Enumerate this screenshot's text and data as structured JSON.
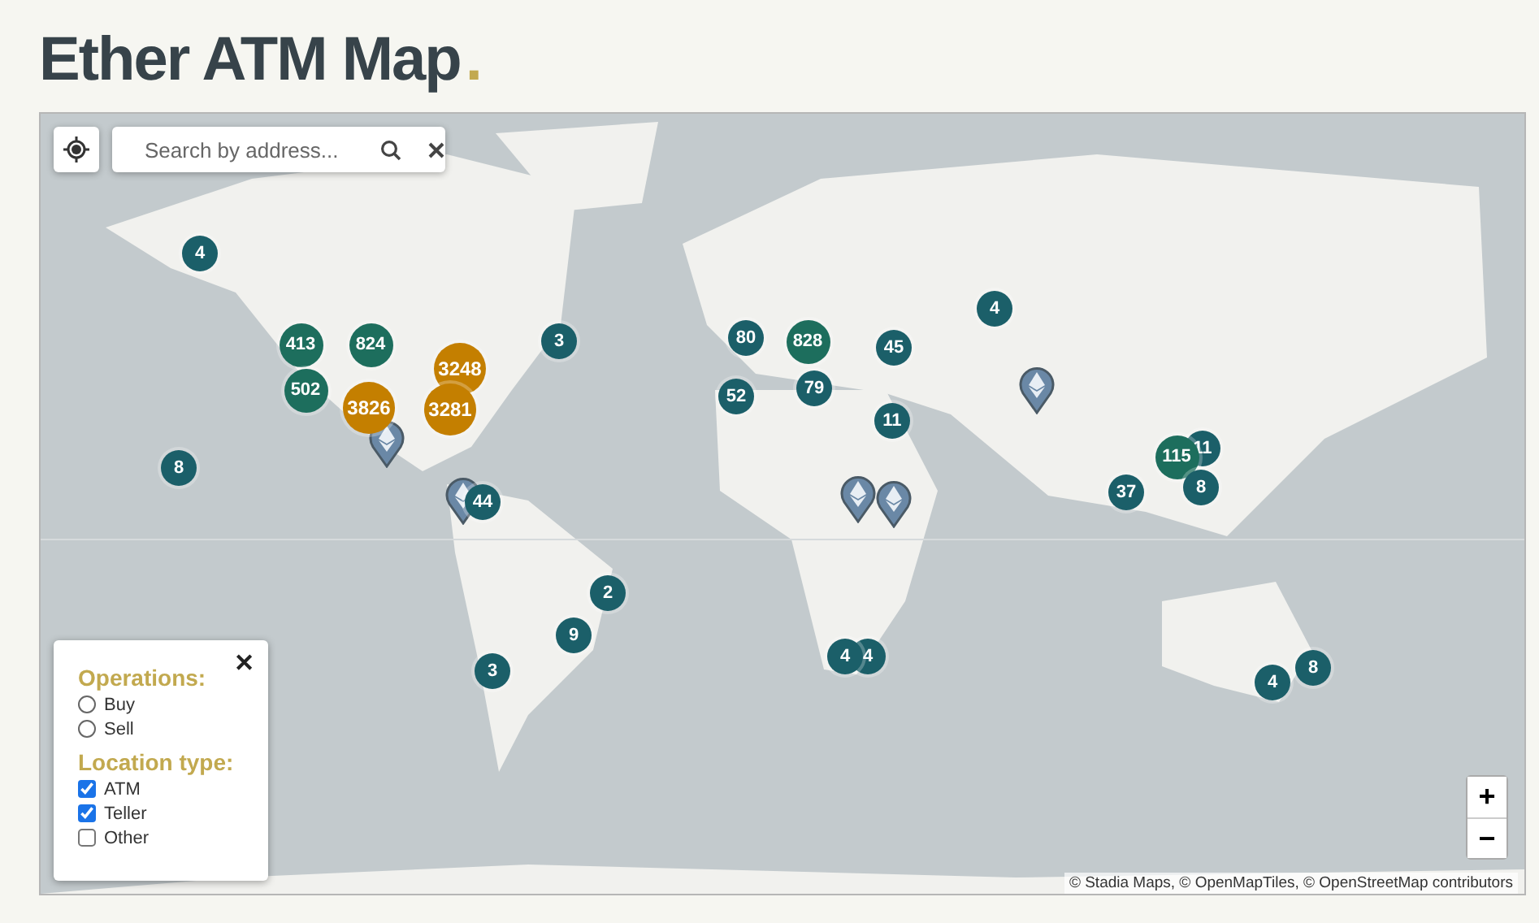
{
  "title": {
    "text": "Ether ATM Map",
    "dot": "."
  },
  "map": {
    "search": {
      "placeholder": "Search by address..."
    },
    "markers": [
      {
        "kind": "cluster",
        "label": "4",
        "color": "#1b5f69"
      },
      {
        "kind": "cluster",
        "label": "413",
        "color": "#1d6e5d"
      },
      {
        "kind": "cluster",
        "label": "824",
        "color": "#1d6e5d"
      },
      {
        "kind": "cluster",
        "label": "502",
        "color": "#1d6e5d"
      },
      {
        "kind": "cluster",
        "label": "3248",
        "color": "#c47f00"
      },
      {
        "kind": "cluster",
        "label": "3826",
        "color": "#c47f00"
      },
      {
        "kind": "cluster",
        "label": "3281",
        "color": "#c47f00"
      },
      {
        "kind": "cluster",
        "label": "3",
        "color": "#1b5f69"
      },
      {
        "kind": "cluster",
        "label": "8",
        "color": "#1b5f69"
      },
      {
        "kind": "cluster",
        "label": "44",
        "color": "#1b5f69"
      },
      {
        "kind": "cluster",
        "label": "2",
        "color": "#1b5f69"
      },
      {
        "kind": "cluster",
        "label": "9",
        "color": "#1b5f69"
      },
      {
        "kind": "cluster",
        "label": "3",
        "color": "#1b5f69"
      },
      {
        "kind": "cluster",
        "label": "80",
        "color": "#1b5f69"
      },
      {
        "kind": "cluster",
        "label": "828",
        "color": "#1d6e5d"
      },
      {
        "kind": "cluster",
        "label": "45",
        "color": "#1b5f69"
      },
      {
        "kind": "cluster",
        "label": "52",
        "color": "#1b5f69"
      },
      {
        "kind": "cluster",
        "label": "79",
        "color": "#1b5f69"
      },
      {
        "kind": "cluster",
        "label": "11",
        "color": "#1b5f69"
      },
      {
        "kind": "cluster",
        "label": "4",
        "color": "#1b5f69"
      },
      {
        "kind": "cluster",
        "label": "11",
        "color": "#1b5f69"
      },
      {
        "kind": "cluster",
        "label": "115",
        "color": "#1d6e5d"
      },
      {
        "kind": "cluster",
        "label": "8",
        "color": "#1b5f69"
      },
      {
        "kind": "cluster",
        "label": "37",
        "color": "#1b5f69"
      },
      {
        "kind": "cluster",
        "label": "4",
        "color": "#1b5f69"
      },
      {
        "kind": "cluster",
        "label": "4",
        "color": "#1b5f69"
      },
      {
        "kind": "cluster",
        "label": "4",
        "color": "#1b5f69"
      },
      {
        "kind": "cluster",
        "label": "8",
        "color": "#1b5f69"
      },
      {
        "kind": "pin"
      },
      {
        "kind": "pin"
      },
      {
        "kind": "pin"
      },
      {
        "kind": "pin"
      },
      {
        "kind": "pin"
      }
    ],
    "zoom": {
      "in": "+",
      "out": "−"
    },
    "attribution": "© Stadia Maps, © OpenMapTiles, © OpenStreetMap contributors"
  },
  "filters": {
    "close": "✕",
    "operations": {
      "heading": "Operations:",
      "options": [
        {
          "label": "Buy",
          "selected": false
        },
        {
          "label": "Sell",
          "selected": false
        }
      ]
    },
    "location_type": {
      "heading": "Location type:",
      "options": [
        {
          "label": "ATM",
          "checked": true
        },
        {
          "label": "Teller",
          "checked": true
        },
        {
          "label": "Other",
          "checked": false
        }
      ]
    }
  }
}
